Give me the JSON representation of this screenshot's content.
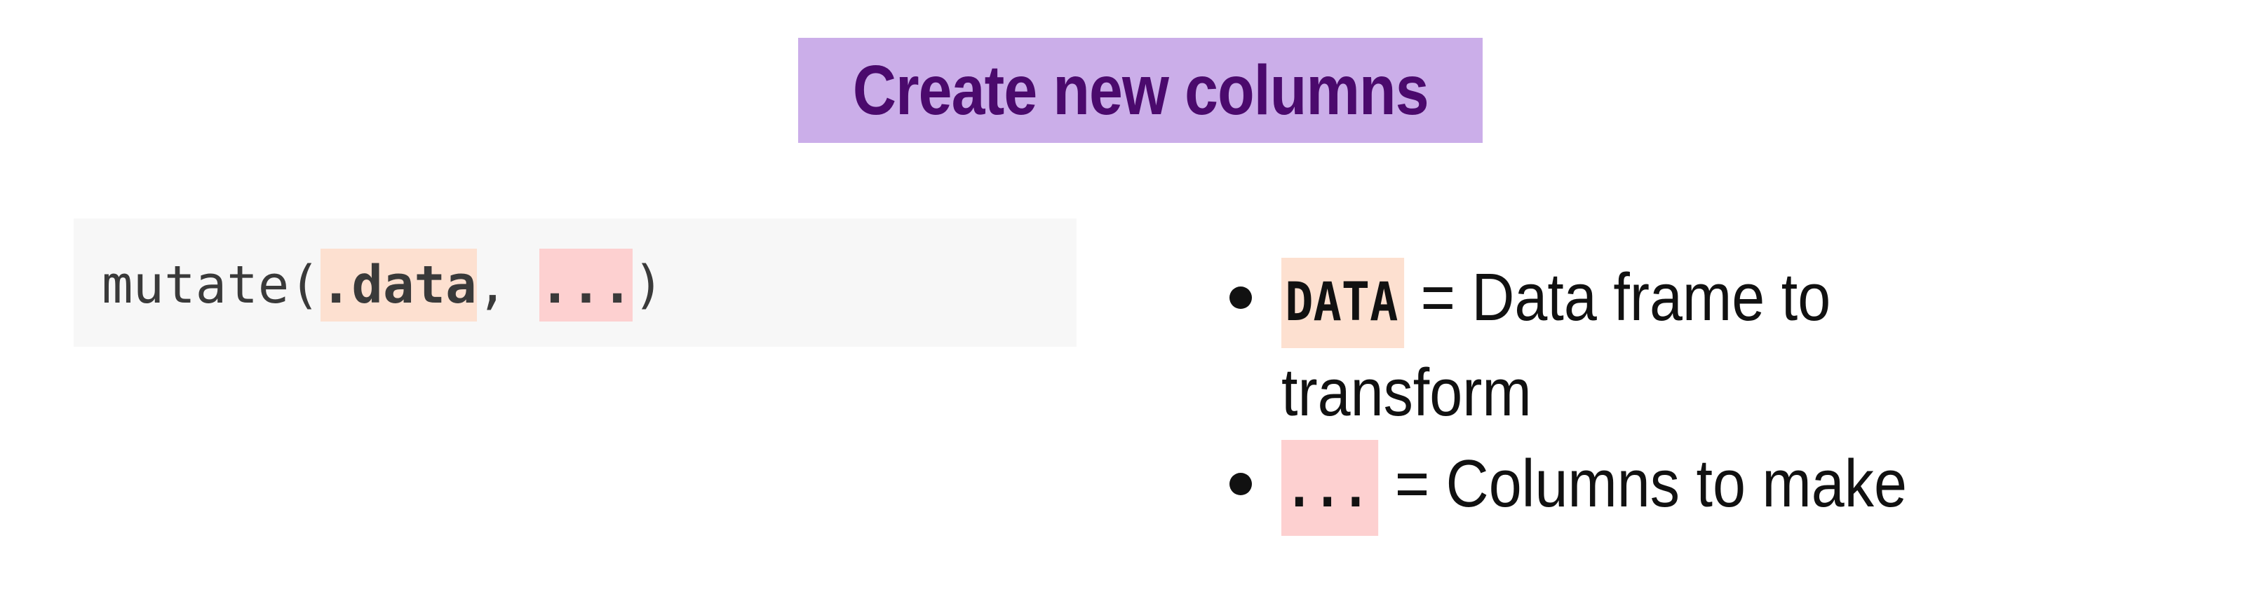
{
  "slide": {
    "title": "Create new columns",
    "code": {
      "fn_open": "mutate(",
      "arg1": ".data",
      "sep": ", ",
      "arg2": "...",
      "close": ")"
    },
    "bullets": [
      {
        "keyword": "DATA",
        "text": " = Data frame to transform"
      },
      {
        "keyword": "...",
        "text": " = Columns to make"
      }
    ]
  },
  "colors": {
    "title_bg": "#cbaee9",
    "title_fg": "#4b0a6d",
    "code_bg": "#f7f7f7",
    "data_highlight": "#fde0d0",
    "dots_highlight": "#fdd0d0"
  }
}
